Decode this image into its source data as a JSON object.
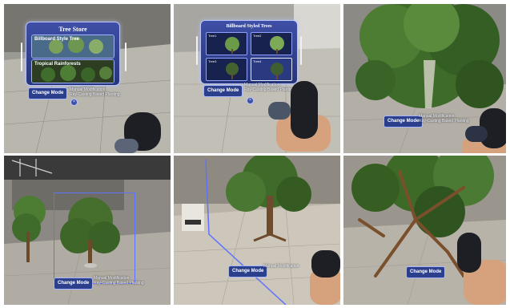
{
  "panels": {
    "p1": {
      "menu_title": "Tree Store",
      "option1": "Billboard Style Tree",
      "option2": "Tropical Rainforests",
      "change_button": "Change Mode",
      "note_line1": "Manual Modification",
      "note_line2": "Ray-Casting Based Planting"
    },
    "p2": {
      "menu_title": "Billboard Styled Trees",
      "cards": [
        "Tree1",
        "Tree2",
        "Tree3",
        "Tree4"
      ],
      "change_button": "Change Mode",
      "note_line1": "Manual Modification",
      "note_line2": "Ray-Casting Based Planting"
    },
    "p3": {
      "change_button": "Change Mode",
      "note_line1": "Manual Modification",
      "note_line2": "Ray-Casting Based Planting"
    },
    "p4": {
      "change_button": "Change Mode",
      "note_line1": "Manual Modification",
      "note_line2": "Ray-Casting Based Planting"
    },
    "p5": {
      "change_button": "Change Mode",
      "note_line1": "Manual Modification"
    },
    "p6": {
      "change_button": "Change Mode"
    }
  },
  "colors": {
    "menu_blue": "#2b3f8c",
    "menu_border": "#b9c4ff",
    "floor_gray": "#b9b6ae",
    "foliage": "#3e6b2a"
  }
}
